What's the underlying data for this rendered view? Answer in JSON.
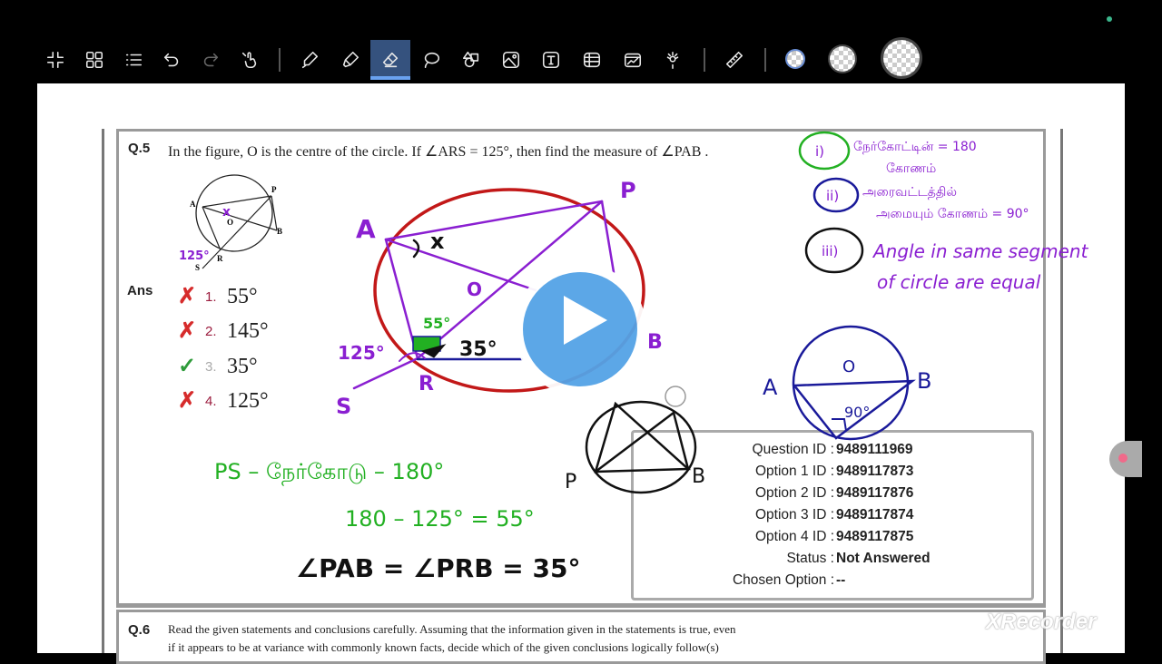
{
  "toolbar": {
    "tools": [
      {
        "name": "collapse-icon",
        "label": "Collapse"
      },
      {
        "name": "grid-view-icon",
        "label": "Pages"
      },
      {
        "name": "list-icon",
        "label": "List"
      },
      {
        "name": "undo-icon",
        "label": "Undo"
      },
      {
        "name": "redo-icon",
        "label": "Redo",
        "disabled": true
      },
      {
        "name": "touch-draw-icon",
        "label": "Touch drawing"
      },
      {
        "name": "pen-icon",
        "label": "Pen"
      },
      {
        "name": "highlighter-icon",
        "label": "Highlighter"
      },
      {
        "name": "eraser-icon",
        "label": "Eraser",
        "active": true
      },
      {
        "name": "lasso-icon",
        "label": "Lasso"
      },
      {
        "name": "shapes-icon",
        "label": "Shapes"
      },
      {
        "name": "image-icon",
        "label": "Image"
      },
      {
        "name": "text-icon",
        "label": "Text",
        "glyph": "T"
      },
      {
        "name": "table-icon",
        "label": "Table"
      },
      {
        "name": "chart-icon",
        "label": "Chart"
      },
      {
        "name": "laser-pointer-icon",
        "label": "Laser"
      },
      {
        "name": "ruler-icon",
        "label": "Ruler"
      }
    ],
    "eraser_sizes": [
      "small",
      "medium",
      "large"
    ],
    "active_tool": "eraser"
  },
  "question5": {
    "number": "Q.5",
    "text": "In the figure, O is the centre of the circle. If ∠ARS = 125°, then find the measure of ∠PAB .",
    "figure_labels": [
      "A",
      "P",
      "O",
      "B",
      "R",
      "S"
    ],
    "ans_label": "Ans",
    "options": [
      {
        "num": "1.",
        "value": "55°",
        "mark": "wrong"
      },
      {
        "num": "2.",
        "value": "145°",
        "mark": "wrong"
      },
      {
        "num": "3.",
        "value": "35°",
        "mark": "correct"
      },
      {
        "num": "4.",
        "value": "125°",
        "mark": "wrong"
      }
    ],
    "info": [
      {
        "label": "Question ID :",
        "value": "9489111969"
      },
      {
        "label": "Option 1 ID :",
        "value": "9489117873"
      },
      {
        "label": "Option 2 ID :",
        "value": "9489117876"
      },
      {
        "label": "Option 3 ID :",
        "value": "9489117874"
      },
      {
        "label": "Option 4 ID :",
        "value": "9489117875"
      },
      {
        "label": "Status :",
        "value": "Not Answered"
      },
      {
        "label": "Chosen Option :",
        "value": "--"
      }
    ]
  },
  "annotations": {
    "small_fig_x": "x",
    "small_fig_125": "125°",
    "big_labels": {
      "A": "A",
      "P": "P",
      "O": "O",
      "R": "R",
      "S": "S",
      "B": "B",
      "x": "x",
      "a125": "125°",
      "a55": "55°",
      "a35": "35°"
    },
    "notes": {
      "n1_mark": "i)",
      "n1_text": "நேர்கோட்டின் = 180",
      "n1_text2": "கோணம்",
      "n2_mark": "ii)",
      "n2_text": "அரைவட்டத்தில்",
      "n2_text2": "அமையும் கோணம் = 90°",
      "n3_mark": "iii)",
      "n3_text": "Angle in same segment",
      "n3_text2": "of circle are equal"
    },
    "work": {
      "line1": "PS – நேர்கோடு – 180°",
      "line2": "180 – 125° = 55°",
      "line3": "∠PAB = ∠PRB = 35°"
    },
    "sketch2": {
      "A": "A",
      "O": "O",
      "B": "B",
      "a90": "90°"
    },
    "sketch3": {
      "P": "P",
      "B": "B"
    }
  },
  "question6": {
    "number": "Q.6",
    "line1": "Read the given statements and conclusions carefully. Assuming that the information given in the statements is true, even",
    "line2": "if it appears to be at variance with commonly known facts, decide which of the given conclusions logically follow(s)"
  },
  "watermark": "XRecorder",
  "colors": {
    "accent": "#35527e",
    "play": "#54a3e6",
    "ink_purple": "#8a1fd1",
    "ink_green": "#22b022",
    "ink_red": "#c21818",
    "ink_blue": "#1a1a9a"
  }
}
